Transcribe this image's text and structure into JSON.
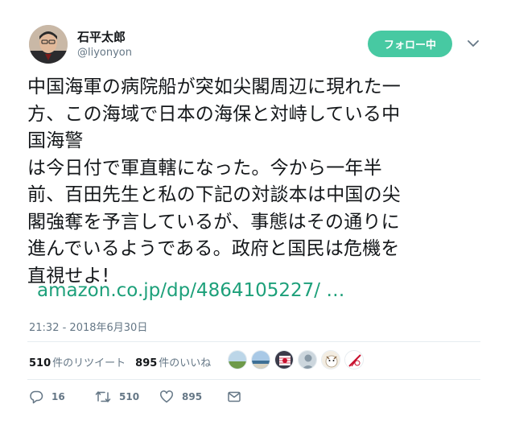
{
  "user": {
    "display_name": "石平太郎",
    "handle": "@liyonyon"
  },
  "follow_button_label": "フォロー中",
  "tweet": {
    "lines": [
      "中国海軍の病院船が突如尖閣周辺に現れた一",
      "方、この海域で日本の海保と対峙している中",
      "国海警",
      "は今日付で軍直轄になった。今から一年半",
      "前、百田先生と私の下記の対談本は中国の尖",
      "閣強奪を予言しているが、事態はその通りに",
      "進んでいるようである。政府と国民は危機を",
      "直視せよ!"
    ],
    "link": "amazon.co.jp/dp/4864105227/ …",
    "timestamp": "21:32 - 2018年6月30日"
  },
  "stats": {
    "retweet_count": "510",
    "retweet_label": "件のリツイート",
    "like_count": "895",
    "like_label": "件のいいね"
  },
  "actions": {
    "reply_count": "16",
    "retweet_count": "510",
    "like_count": "895"
  },
  "colors": {
    "accent": "#47c9a2",
    "link": "#1da07a",
    "muted": "#657786",
    "text": "#14171a",
    "divider": "#e6ecf0"
  },
  "icons": [
    "reply-icon",
    "retweet-icon",
    "heart-icon",
    "message-icon",
    "chevron-down-icon"
  ]
}
